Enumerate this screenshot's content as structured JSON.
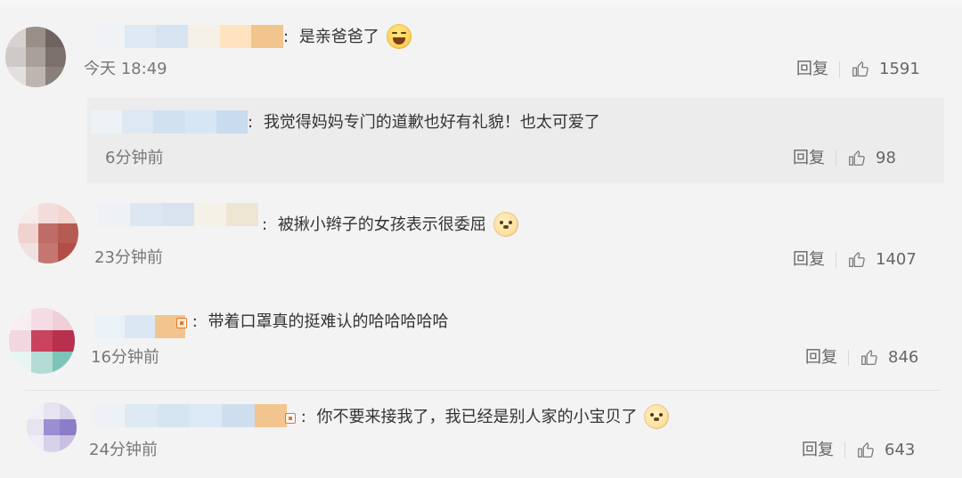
{
  "colors": {
    "page_bg": "#f3f3f3",
    "reply_bg": "#ececec",
    "text": "#333333",
    "meta": "#777777",
    "action": "#666666"
  },
  "comments": [
    {
      "text": "是亲爸爸了",
      "emoji": "laugh-emoji",
      "time": "今天 18:49",
      "reply_label": "回复",
      "likes": "1591"
    },
    {
      "text": "我觉得妈妈专门的道歉也好有礼貌！也太可爱了",
      "emoji": "",
      "time": "6分钟前",
      "reply_label": "回复",
      "likes": "98"
    },
    {
      "text": "被揪小辫子的女孩表示很委屈",
      "emoji": "doge-emoji",
      "time": "23分钟前",
      "reply_label": "回复",
      "likes": "1407"
    },
    {
      "text": "带着口罩真的挺难认的哈哈哈哈哈",
      "emoji": "",
      "time": "16分钟前",
      "reply_label": "回复",
      "likes": "846"
    },
    {
      "text": "你不要来接我了，我已经是别人家的小宝贝了",
      "emoji": "doge-emoji",
      "time": "24分钟前",
      "reply_label": "回复",
      "likes": "643"
    }
  ]
}
